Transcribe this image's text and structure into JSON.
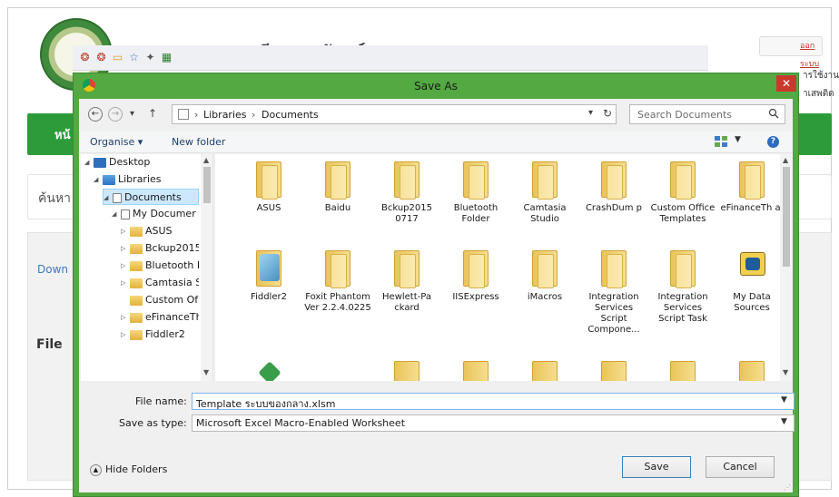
{
  "background_page": {
    "site_title": "ระบบทะเบียนครุภัณฑ์",
    "right_link": "ออกระบบ",
    "right_text_1": "ารใช้งาน",
    "right_text_2": "าเสพติด",
    "nav_text": "หน้",
    "search_text": "ค้นหา",
    "download_text": "Down",
    "file_label": "File"
  },
  "dialog": {
    "title": "Save As",
    "close_label": "✕",
    "address": {
      "parts": [
        "Libraries",
        "Documents"
      ],
      "separator": "›"
    },
    "search_placeholder": "Search Documents",
    "commands": {
      "organise": "Organise ▾",
      "new_folder": "New folder"
    },
    "tree": [
      {
        "label": "Desktop",
        "icon": "desktop-icon"
      },
      {
        "label": "Libraries",
        "icon": "libraries-icon"
      },
      {
        "label": "Documents",
        "icon": "documents-icon"
      },
      {
        "label": "My Documer",
        "icon": "documents-icon"
      },
      {
        "label": "ASUS",
        "icon": "folder-icon"
      },
      {
        "label": "Bckup2015",
        "icon": "folder-icon"
      },
      {
        "label": "Bluetooth F",
        "icon": "folder-icon"
      },
      {
        "label": "Camtasia S",
        "icon": "folder-icon"
      },
      {
        "label": "Custom Of",
        "icon": "folder-icon"
      },
      {
        "label": "eFinanceTh",
        "icon": "folder-icon"
      },
      {
        "label": "Fiddler2",
        "icon": "folder-icon"
      }
    ],
    "files": [
      {
        "label": "ASUS",
        "icon": "folder-icon"
      },
      {
        "label": "Baidu",
        "icon": "folder-icon"
      },
      {
        "label": "Bckup2015 0717",
        "icon": "folder-icon"
      },
      {
        "label": "Bluetooth Folder",
        "icon": "folder-icon"
      },
      {
        "label": "Camtasia Studio",
        "icon": "folder-icon"
      },
      {
        "label": "CrashDum p",
        "icon": "folder-icon"
      },
      {
        "label": "Custom Office Templates",
        "icon": "folder-icon"
      },
      {
        "label": "eFinanceTh ai",
        "icon": "folder-icon"
      },
      {
        "label": "Fiddler2",
        "icon": "fiddler-icon"
      },
      {
        "label": "Foxit Phantom Ver 2.2.4.0225",
        "icon": "folder-icon"
      },
      {
        "label": "Hewlett-Pa ckard",
        "icon": "folder-icon"
      },
      {
        "label": "IISExpress",
        "icon": "folder-icon"
      },
      {
        "label": "iMacros",
        "icon": "folder-icon"
      },
      {
        "label": "Integration Services Script Compone...",
        "icon": "folder-icon"
      },
      {
        "label": "Integration Services Script Task",
        "icon": "folder-icon"
      },
      {
        "label": "My Data Sources",
        "icon": "data-sources-icon"
      }
    ],
    "file_name_label": "File name:",
    "file_name_value": "Template ระบบของกลาง.xlsm",
    "save_type_label": "Save as type:",
    "save_type_value": "Microsoft Excel Macro-Enabled Worksheet",
    "hide_folders": "Hide Folders",
    "save_button": "Save",
    "cancel_button": "Cancel"
  }
}
